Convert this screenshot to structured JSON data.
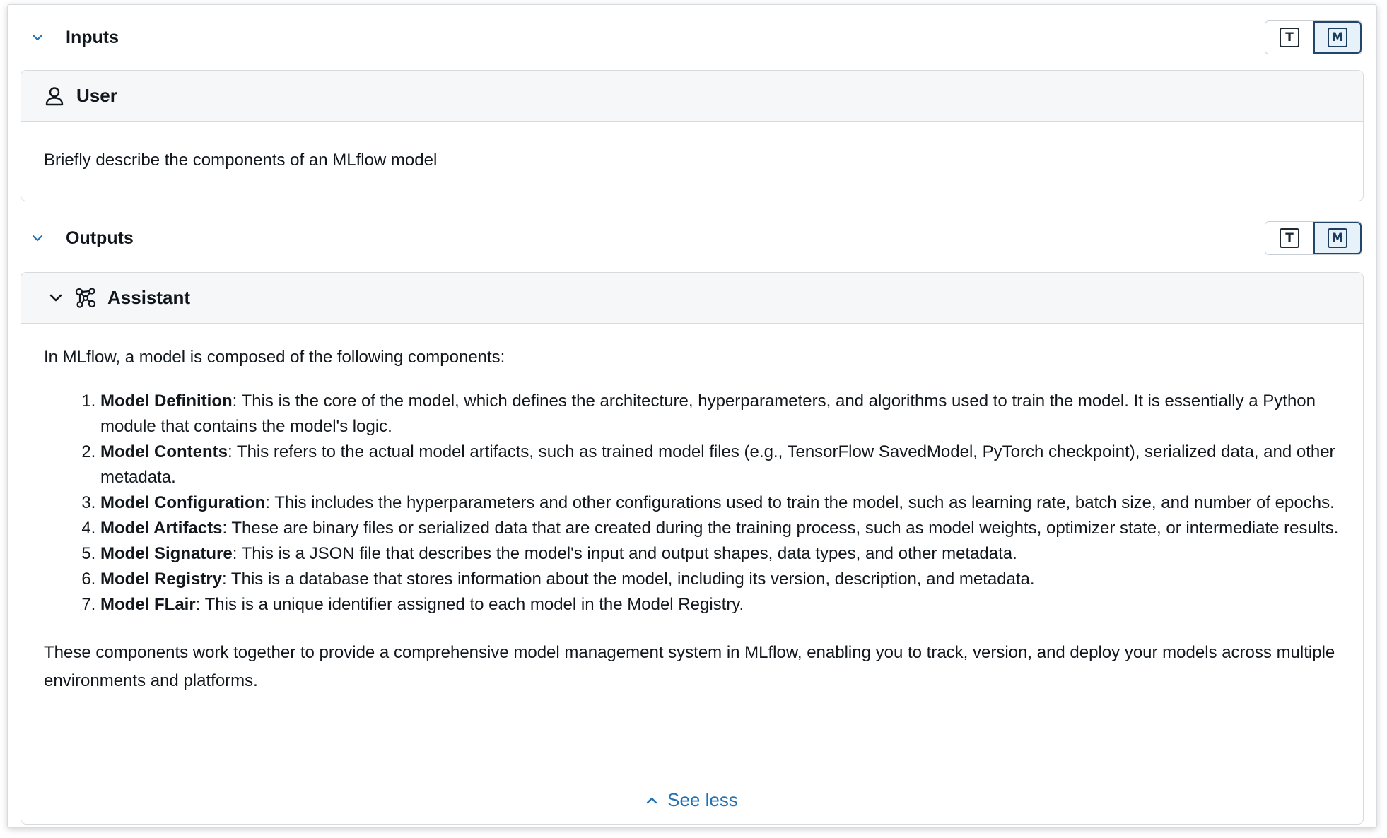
{
  "inputs": {
    "title": "Inputs",
    "toggle_text": "T",
    "toggle_markdown": "M",
    "message": {
      "role": "User",
      "content": "Briefly describe the components of an MLflow model"
    }
  },
  "outputs": {
    "title": "Outputs",
    "toggle_text": "T",
    "toggle_markdown": "M",
    "message": {
      "role": "Assistant",
      "intro": "In MLflow, a model is composed of the following components:",
      "items": [
        {
          "term": "Model Definition",
          "text": ": This is the core of the model, which defines the architecture, hyperparameters, and algorithms used to train the model. It is essentially a Python module that contains the model's logic."
        },
        {
          "term": "Model Contents",
          "text": ": This refers to the actual model artifacts, such as trained model files (e.g., TensorFlow SavedModel, PyTorch checkpoint), serialized data, and other metadata."
        },
        {
          "term": "Model Configuration",
          "text": ": This includes the hyperparameters and other configurations used to train the model, such as learning rate, batch size, and number of epochs."
        },
        {
          "term": "Model Artifacts",
          "text": ": These are binary files or serialized data that are created during the training process, such as model weights, optimizer state, or intermediate results."
        },
        {
          "term": "Model Signature",
          "text": ": This is a JSON file that describes the model's input and output shapes, data types, and other metadata."
        },
        {
          "term": "Model Registry",
          "text": ": This is a database that stores information about the model, including its version, description, and metadata."
        },
        {
          "term": "Model FLair",
          "text": ": This is a unique identifier assigned to each model in the Model Registry."
        }
      ],
      "outro": "These components work together to provide a comprehensive model management system in MLflow, enabling you to track, version, and deploy your models across multiple environments and platforms.",
      "see_less": "See less"
    }
  },
  "colors": {
    "accent": "#2272b4",
    "active_toggle_bg": "#e6f1fa",
    "active_toggle_border": "#22466b",
    "card_header_bg": "#f6f7f9"
  },
  "icons": {
    "collapse": "chevron-down-icon",
    "user": "user-icon",
    "assistant": "sparkle-nodes-icon",
    "see_less": "chevron-up-icon"
  }
}
